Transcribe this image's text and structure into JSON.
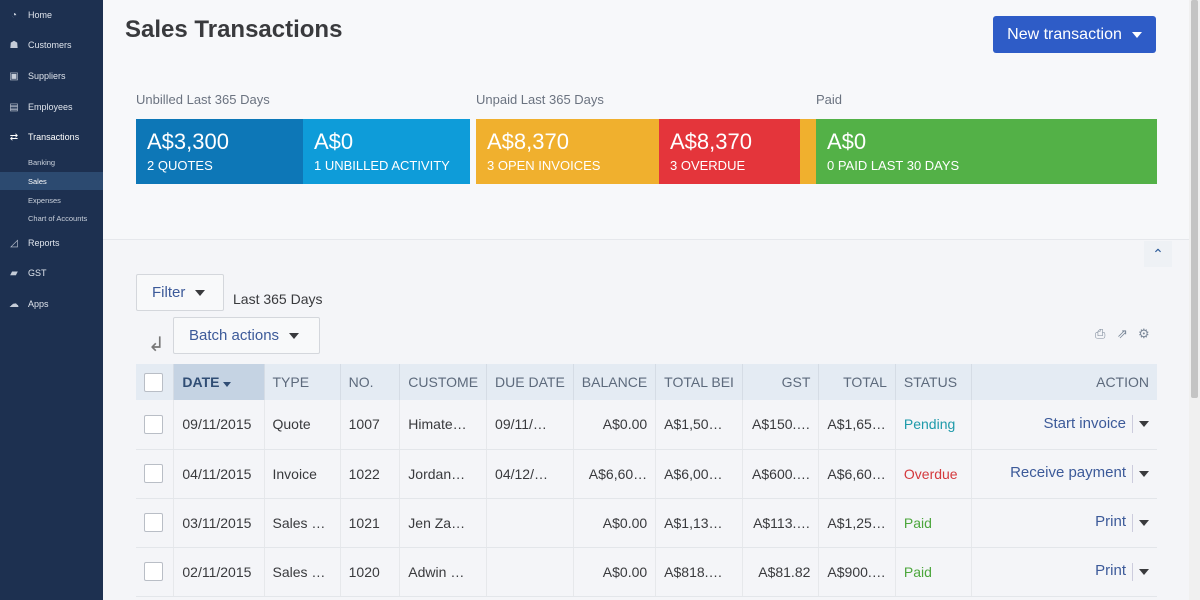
{
  "sidebar": {
    "items": [
      {
        "label": "Home",
        "icon": "dashboard-icon"
      },
      {
        "label": "Customers",
        "icon": "customers-icon"
      },
      {
        "label": "Suppliers",
        "icon": "suppliers-icon"
      },
      {
        "label": "Employees",
        "icon": "employees-icon"
      },
      {
        "label": "Transactions",
        "icon": "transactions-icon"
      },
      {
        "label": "Reports",
        "icon": "reports-icon"
      },
      {
        "label": "GST",
        "icon": "gst-icon"
      },
      {
        "label": "Apps",
        "icon": "apps-icon"
      }
    ],
    "sub_items": [
      {
        "label": "Banking"
      },
      {
        "label": "Sales",
        "active": true
      },
      {
        "label": "Expenses"
      },
      {
        "label": "Chart of Accounts"
      }
    ]
  },
  "header": {
    "title": "Sales Transactions",
    "new_transaction_label": "New transaction"
  },
  "summary": {
    "groups": [
      "Unbilled Last 365 Days",
      "Unpaid Last 365 Days",
      "Paid"
    ],
    "cards": [
      {
        "amount": "A$3,300",
        "label": "2 QUOTES",
        "color": "#0d77b7"
      },
      {
        "amount": "A$0",
        "label": "1 UNBILLED ACTIVITY",
        "color": "#0e9cd9"
      },
      {
        "amount": "A$8,370",
        "label": "3 OPEN INVOICES",
        "color": "#f0b02e"
      },
      {
        "amount": "A$8,370",
        "label": "3 OVERDUE",
        "color": "#e4353b"
      },
      {
        "amount": "A$0",
        "label": "0 PAID LAST 30 DAYS",
        "color": "#53b147"
      }
    ]
  },
  "toolbar": {
    "filter_label": "Filter",
    "period": "Last 365 Days",
    "batch_label": "Batch actions"
  },
  "table": {
    "columns": [
      "DATE",
      "TYPE",
      "NO.",
      "CUSTOMER",
      "DUE DATE",
      "BALANCE",
      "TOTAL BEFORE GST",
      "GST",
      "TOTAL",
      "STATUS",
      "ACTION"
    ],
    "column_display": [
      "DATE",
      "TYPE",
      "NO.",
      "CUSTOME",
      "DUE DATE",
      "BALANCE",
      "TOTAL BEI",
      "GST",
      "TOTAL",
      "STATUS",
      "ACTION"
    ],
    "rows": [
      {
        "date": "09/11/2015",
        "type": "Quote",
        "no": "1007",
        "customer": "Himate…",
        "due": "09/11/…",
        "balance": "A$0.00",
        "before": "A$1,50…",
        "gst": "A$150.…",
        "total": "A$1,65…",
        "status": "Pending",
        "status_color": "#1e9aaa",
        "action": "Start invoice"
      },
      {
        "date": "04/11/2015",
        "type": "Invoice",
        "no": "1022",
        "customer": "Jordan…",
        "due": "04/12/…",
        "balance": "A$6,60…",
        "before": "A$6,00…",
        "gst": "A$600.…",
        "total": "A$6,60…",
        "status": "Overdue",
        "status_color": "#d4393d",
        "action": "Receive payment"
      },
      {
        "date": "03/11/2015",
        "type": "Sales …",
        "no": "1021",
        "customer": "Jen Za…",
        "due": "",
        "balance": "A$0.00",
        "before": "A$1,13…",
        "gst": "A$113.…",
        "total": "A$1,25…",
        "status": "Paid",
        "status_color": "#4ca63c",
        "action": "Print"
      },
      {
        "date": "02/11/2015",
        "type": "Sales …",
        "no": "1020",
        "customer": "Adwin …",
        "due": "",
        "balance": "A$0.00",
        "before": "A$818.…",
        "gst": "A$81.82",
        "total": "A$900.…",
        "status": "Paid",
        "status_color": "#4ca63c",
        "action": "Print"
      }
    ]
  }
}
